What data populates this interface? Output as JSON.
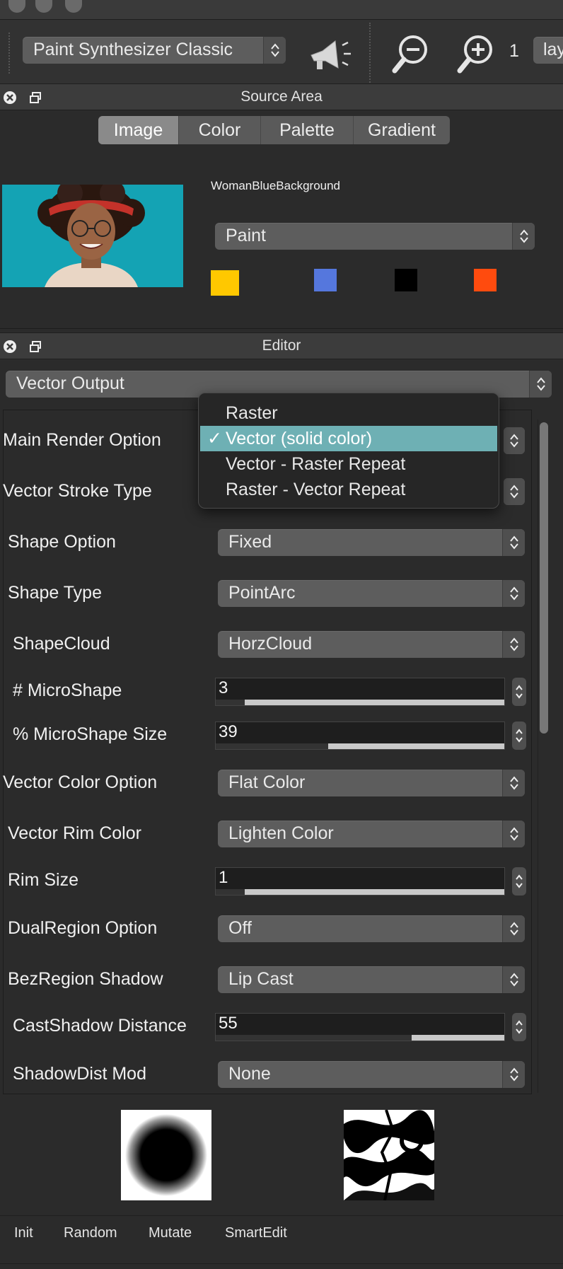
{
  "toolbar": {
    "preset_select": "Paint Synthesizer Classic",
    "zoom_value": "1",
    "layer_select": "lay",
    "icons": [
      "megaphone-icon",
      "zoom-out-icon",
      "zoom-in-icon"
    ]
  },
  "source_area": {
    "title": "Source Area",
    "tabs": [
      {
        "label": "Image",
        "active": true
      },
      {
        "label": "Color",
        "active": false
      },
      {
        "label": "Palette",
        "active": false
      },
      {
        "label": "Gradient",
        "active": false
      }
    ],
    "image_name": "WomanBlueBackground",
    "mode_select": "Paint",
    "swatches": [
      "#ffc800",
      "#5577dd",
      "#000000",
      "#ff4b0e"
    ]
  },
  "editor": {
    "title": "Editor",
    "category_select": "Vector Output",
    "rows": [
      {
        "label": "Main Render Option",
        "type": "select",
        "value": ""
      },
      {
        "label": "Vector Stroke Type",
        "type": "select",
        "value": ""
      },
      {
        "label": "Shape Option",
        "type": "select",
        "value": "Fixed"
      },
      {
        "label": "Shape Type",
        "type": "select",
        "value": "PointArc"
      },
      {
        "label": "ShapeCloud",
        "type": "select",
        "value": "HorzCloud"
      },
      {
        "label": "# MicroShape",
        "type": "number",
        "value": "3",
        "level": 0.1
      },
      {
        "label": "% MicroShape Size",
        "type": "number",
        "value": "39",
        "level": 0.39
      },
      {
        "label": "Vector Color Option",
        "type": "select",
        "value": "Flat Color"
      },
      {
        "label": "Vector Rim Color",
        "type": "select",
        "value": "Lighten Color"
      },
      {
        "label": "Rim Size",
        "type": "number",
        "value": "1",
        "level": 0.1
      },
      {
        "label": "DualRegion Option",
        "type": "select",
        "value": "Off"
      },
      {
        "label": "BezRegion Shadow",
        "type": "select",
        "value": "Lip Cast"
      },
      {
        "label": "CastShadow Distance",
        "type": "number",
        "value": "55",
        "level": 0.68
      },
      {
        "label": "ShadowDist Mod",
        "type": "select",
        "value": "None"
      }
    ],
    "dropdown": {
      "items": [
        "Raster",
        "Vector (solid color)",
        "Vector - Raster Repeat",
        "Raster - Vector Repeat"
      ],
      "selected_index": 1,
      "check_glyph": "✓"
    }
  },
  "bottom": {
    "buttons": [
      "Init",
      "Random",
      "Mutate",
      "SmartEdit"
    ]
  },
  "colors": {
    "menu_highlight": "#6eb0b4",
    "portrait_background": "#14a3b4"
  }
}
